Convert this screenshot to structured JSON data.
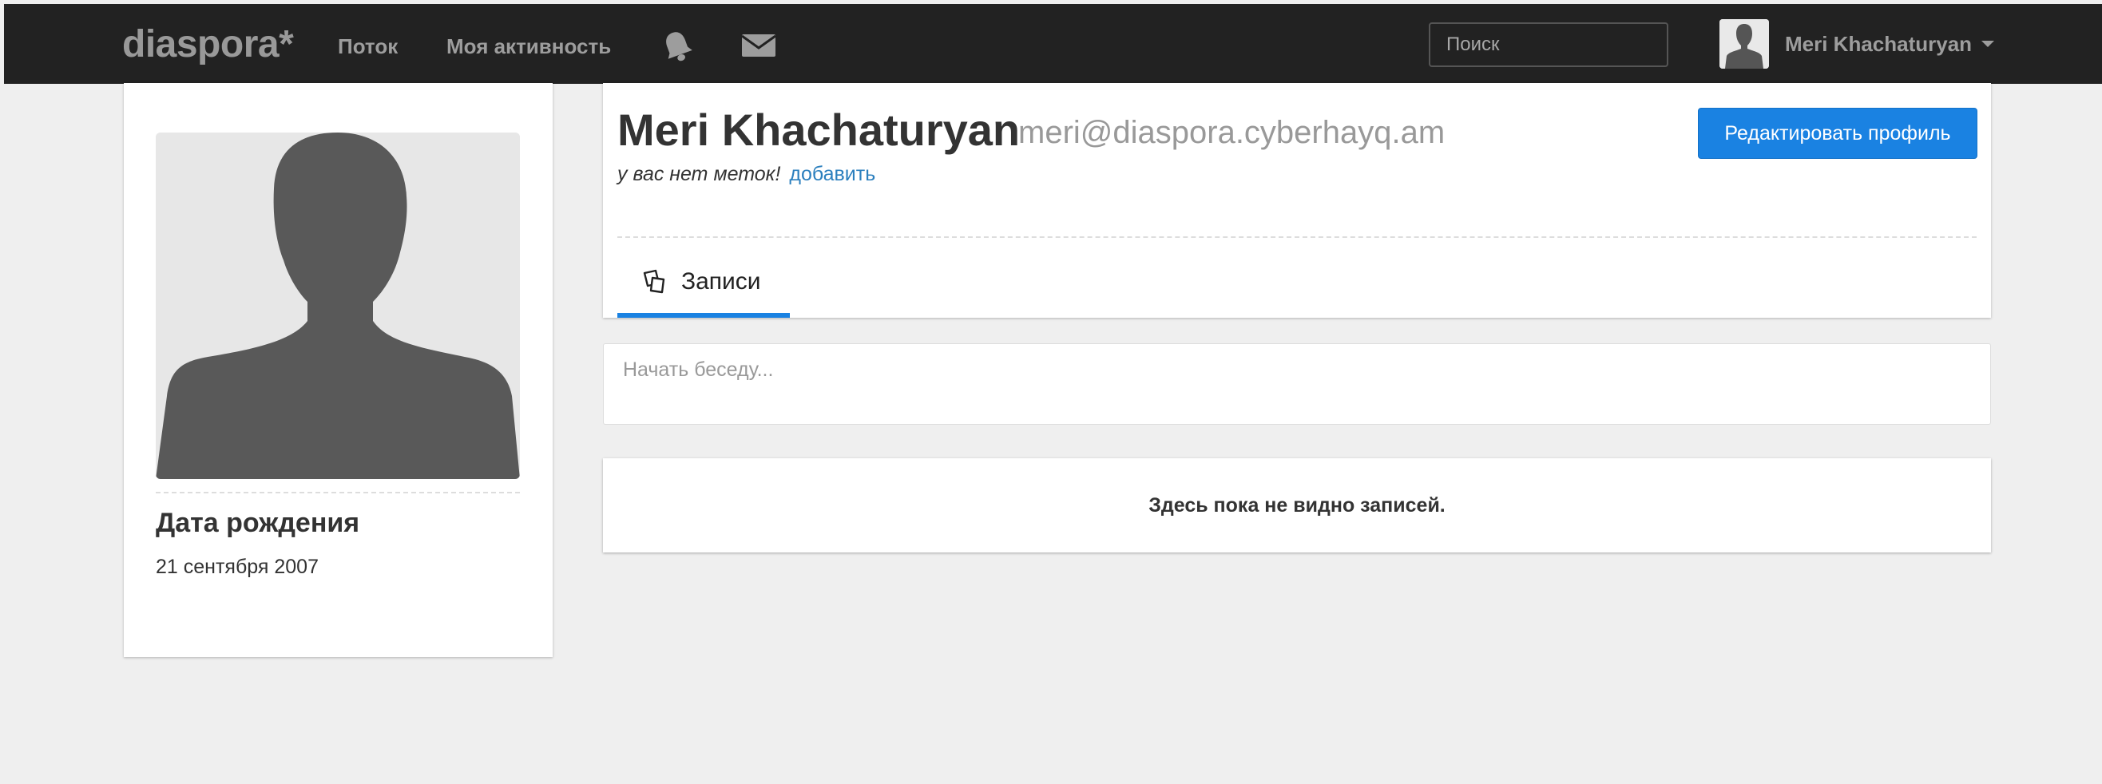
{
  "navbar": {
    "brand": "diaspora*",
    "links": [
      {
        "label": "Поток"
      },
      {
        "label": "Моя активность"
      }
    ],
    "icons": [
      "notifications-bell-icon",
      "conversations-mail-icon"
    ],
    "search": {
      "placeholder": "Поиск",
      "value": ""
    },
    "user": {
      "name": "Meri Khachaturyan",
      "avatar": "default-avatar-icon"
    }
  },
  "profile_sidebar": {
    "photo": "default-avatar-icon",
    "birthday_title": "Дата рождения",
    "birthday_value": "21 сентября 2007"
  },
  "profile_header": {
    "name": "Meri Khachaturyan",
    "handle": "meri@diaspora.cyberhayq.am",
    "no_tags_text": "у вас нет меток!",
    "add_tags_label": "добавить",
    "edit_button_label": "Редактировать профиль",
    "tabs": [
      {
        "label": "Записи",
        "icon": "posts-icon",
        "active": true
      }
    ]
  },
  "publisher": {
    "placeholder": "Начать беседу..."
  },
  "stream": {
    "empty_message": "Здесь пока не видно записей."
  },
  "colors": {
    "navbar_bg": "#222222",
    "page_bg": "#efefef",
    "accent": "#1a82e2",
    "link": "#2b7fbe",
    "muted_text": "#999999"
  }
}
